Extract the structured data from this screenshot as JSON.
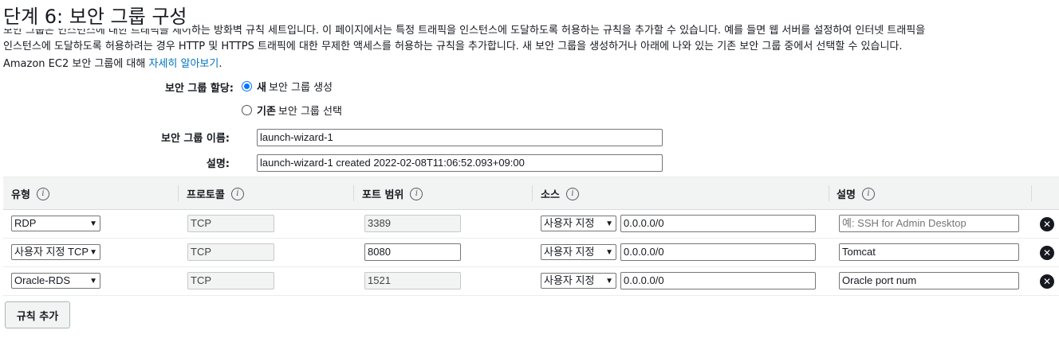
{
  "step_title": "단계 6: 보안 그룹 구성",
  "intro": {
    "cut_line": "보안 그룹은 인스턴스에 대한 트래픽을 제어하는 방화벽 규칙 세트입니다. 이 페이지에서는 특정 트래픽을 인스턴스에 도달하도록 허용하는 규칙을 추가할 수 있습니다. 예를 들면 웹 서버를 설정하여 인터넷 트래픽을",
    "line2": "인스턴스에 도달하도록 허용하려는 경우 HTTP 및 HTTPS 트래픽에 대한 무제한 액세스를 허용하는 규칙을 추가합니다. 새 보안 그룹을 생성하거나 아래에 나와 있는 기존 보안 그룹 중에서 선택할 수 있습니다.",
    "line3_prefix": "Amazon EC2 보안 그룹에 대해 ",
    "learn_more_link": "자세히 알아보기",
    "line3_suffix": "."
  },
  "assignment": {
    "label": "보안 그룹 할당:",
    "options": [
      {
        "bold": "새",
        "rest": "보안 그룹 생성",
        "selected": true
      },
      {
        "bold": "기존",
        "rest": "보안 그룹 선택",
        "selected": false
      }
    ]
  },
  "group_name": {
    "label": "보안 그룹 이름:",
    "value": "launch-wizard-1"
  },
  "description": {
    "label": "설명:",
    "value": "launch-wizard-1 created 2022-02-08T11:06:52.093+09:00"
  },
  "table": {
    "headers": [
      "유형",
      "프로토콜",
      "포트 범위",
      "소스",
      "설명"
    ],
    "info_glyph": "i",
    "rows": [
      {
        "type": "RDP",
        "protocol": "TCP",
        "port": "3389",
        "port_editable": false,
        "source_type": "사용자 지정",
        "source": "0.0.0.0/0",
        "description": "",
        "description_placeholder": "예: SSH for Admin Desktop"
      },
      {
        "type": "사용자 지정 TCP",
        "protocol": "TCP",
        "port": "8080",
        "port_editable": true,
        "source_type": "사용자 지정",
        "source": "0.0.0.0/0",
        "description": "Tomcat",
        "description_placeholder": ""
      },
      {
        "type": "Oracle-RDS",
        "protocol": "TCP",
        "port": "1521",
        "port_editable": false,
        "source_type": "사용자 지정",
        "source": "0.0.0.0/0",
        "description": "Oracle port num",
        "description_placeholder": ""
      }
    ],
    "remove_glyph": "✕"
  },
  "add_rule_button": "규칙 추가",
  "colors": {
    "link": "#0073bb",
    "radio_selected": "#0075ff",
    "header_bg": "#f2f3f3",
    "remove_icon": "#16191f"
  }
}
